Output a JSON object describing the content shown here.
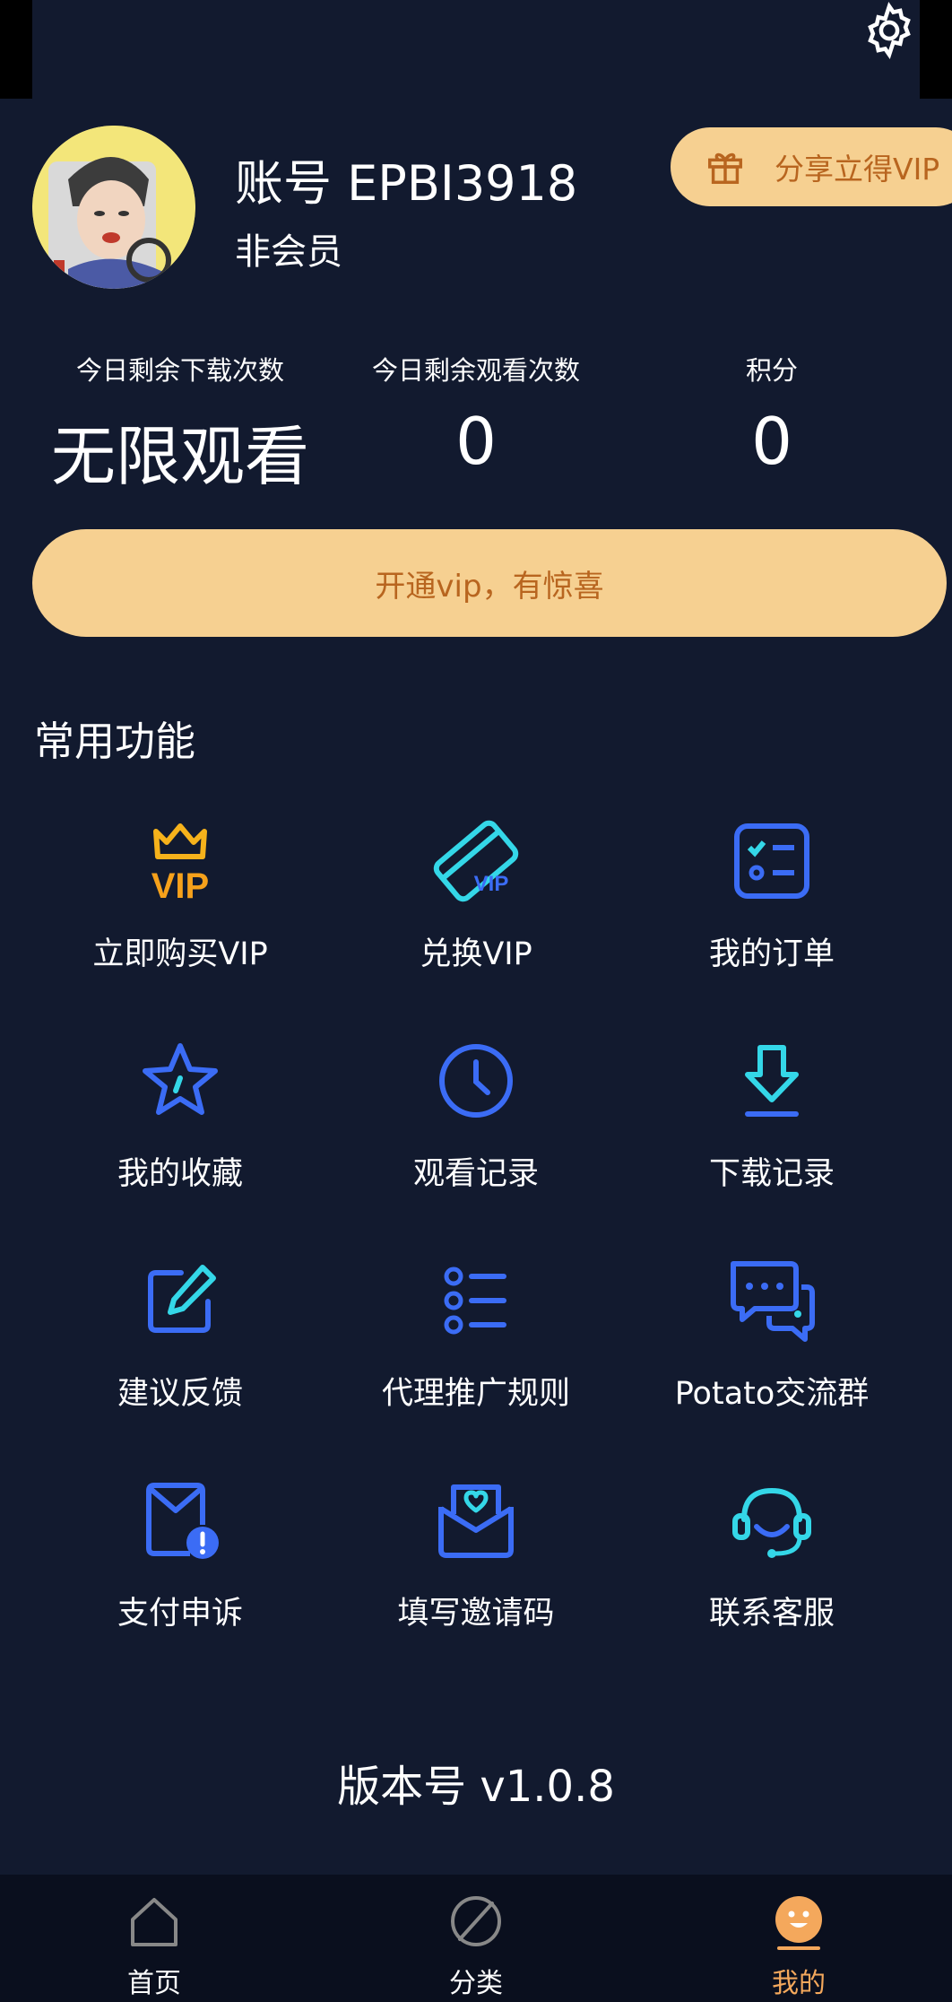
{
  "header": {
    "account_title": "账号 EPBI3918",
    "member_status": "非会员",
    "share_label": "分享立得VIP"
  },
  "stats": [
    {
      "label": "今日剩余下载次数",
      "value": "无限观看"
    },
    {
      "label": "今日剩余观看次数",
      "value": "0"
    },
    {
      "label": "积分",
      "value": "0"
    }
  ],
  "vip_banner": {
    "label": "开通vip，有惊喜"
  },
  "features": {
    "title": "常用功能",
    "items": [
      {
        "label": "立即购买VIP",
        "icon": "crown-vip-icon"
      },
      {
        "label": "兑换VIP",
        "icon": "vip-card-icon"
      },
      {
        "label": "我的订单",
        "icon": "order-list-icon"
      },
      {
        "label": "我的收藏",
        "icon": "star-icon"
      },
      {
        "label": "观看记录",
        "icon": "clock-icon"
      },
      {
        "label": "下载记录",
        "icon": "download-icon"
      },
      {
        "label": "建议反馈",
        "icon": "edit-pencil-icon"
      },
      {
        "label": "代理推广规则",
        "icon": "list-icon"
      },
      {
        "label": "Potato交流群",
        "icon": "chat-bubbles-icon"
      },
      {
        "label": "支付申诉",
        "icon": "mail-alert-icon"
      },
      {
        "label": "填写邀请码",
        "icon": "heart-envelope-icon"
      },
      {
        "label": "联系客服",
        "icon": "headset-icon"
      }
    ]
  },
  "version": "版本号 v1.0.8",
  "tabbar": {
    "items": [
      {
        "label": "首页",
        "icon": "home-icon"
      },
      {
        "label": "分类",
        "icon": "compass-icon"
      },
      {
        "label": "我的",
        "icon": "profile-smile-icon"
      }
    ],
    "active_index": 2
  },
  "colors": {
    "background": "#121a2f",
    "accent_gold": "#f6d091",
    "accent_text": "#b8651f",
    "icon_blue": "#3b6cf5",
    "icon_cyan": "#34d7e8",
    "active_tab": "#f4a85c"
  }
}
